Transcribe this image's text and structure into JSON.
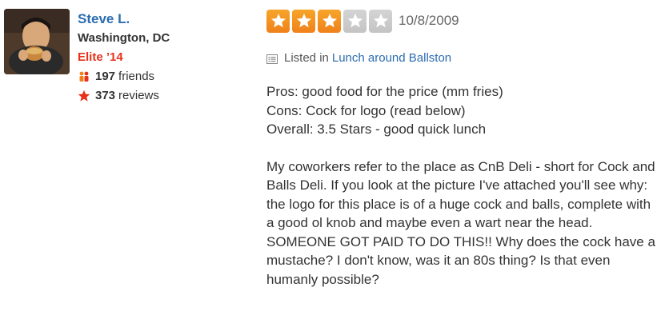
{
  "user": {
    "name": "Steve L.",
    "location": "Washington, DC",
    "elite": "Elite ’14",
    "friends_count": "197",
    "friends_label": "friends",
    "reviews_count": "373",
    "reviews_label": "reviews",
    "avatar_icon": "user-photo"
  },
  "review": {
    "rating": 3,
    "rating_max": 5,
    "date": "10/8/2009",
    "listed_prefix": "Listed in",
    "list_name": "Lunch around Ballston",
    "lines": [
      "Pros: good food for the price (mm fries)",
      "Cons: Cock for logo (read below)",
      "Overall: 3.5 Stars - good quick lunch"
    ],
    "paragraph": "My coworkers refer to the place as CnB Deli - short for Cock and Balls Deli. If you look at the picture I've attached you'll see why: the logo for this place is of a huge cock and balls, complete with a good ol knob and maybe even a wart near the head. SOMEONE GOT PAID TO DO THIS!! Why does the cock have a mustache? I don't know, was it an 80s thing? Is that even humanly possible?"
  },
  "colors": {
    "link": "#2b6cb0",
    "elite": "#e8311a",
    "star_on": "#f0811a",
    "star_off": "#c8c8c8"
  }
}
